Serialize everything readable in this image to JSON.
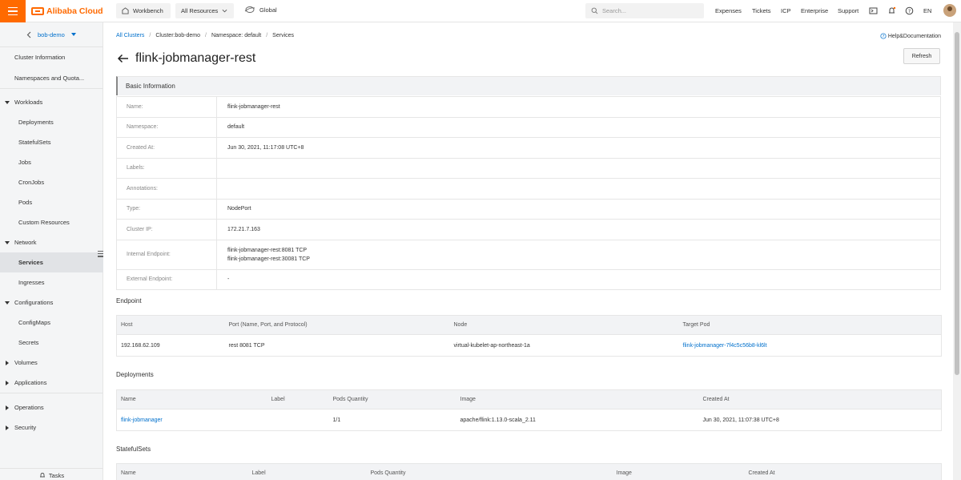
{
  "topbar": {
    "brand": "Alibaba Cloud",
    "workbench": "Workbench",
    "all_resources": "All Resources",
    "region": "Global",
    "search_placeholder": "Search...",
    "links": [
      "Expenses",
      "Tickets",
      "ICP",
      "Enterprise",
      "Support"
    ],
    "language": "EN",
    "accent_color": "#ff6a00"
  },
  "sidebar": {
    "cluster": "bob-demo",
    "items": [
      {
        "label": "Cluster Information",
        "kind": "top"
      },
      {
        "label": "Namespaces and Quota...",
        "kind": "top"
      },
      {
        "label": "Workloads",
        "kind": "group",
        "expanded": true
      },
      {
        "label": "Deployments",
        "kind": "sub"
      },
      {
        "label": "StatefulSets",
        "kind": "sub"
      },
      {
        "label": "Jobs",
        "kind": "sub"
      },
      {
        "label": "CronJobs",
        "kind": "sub"
      },
      {
        "label": "Pods",
        "kind": "sub"
      },
      {
        "label": "Custom Resources",
        "kind": "sub"
      },
      {
        "label": "Network",
        "kind": "group",
        "expanded": true
      },
      {
        "label": "Services",
        "kind": "sub",
        "active": true
      },
      {
        "label": "Ingresses",
        "kind": "sub"
      },
      {
        "label": "Configurations",
        "kind": "group",
        "expanded": true
      },
      {
        "label": "ConfigMaps",
        "kind": "sub"
      },
      {
        "label": "Secrets",
        "kind": "sub"
      },
      {
        "label": "Volumes",
        "kind": "group",
        "expanded": false
      },
      {
        "label": "Applications",
        "kind": "group",
        "expanded": false
      },
      {
        "label": "Operations",
        "kind": "group",
        "expanded": false
      },
      {
        "label": "Security",
        "kind": "group",
        "expanded": false
      }
    ],
    "tasks": "Tasks"
  },
  "breadcrumb": [
    "All Clusters",
    "Cluster:bob-demo",
    "Namespace: default",
    "Services"
  ],
  "help": "Help&Documentation",
  "page_title": "flink-jobmanager-rest",
  "refresh": "Refresh",
  "basic_info": {
    "title": "Basic Information",
    "rows": [
      {
        "key": "Name:",
        "values": [
          "flink-jobmanager-rest"
        ]
      },
      {
        "key": "Namespace:",
        "values": [
          "default"
        ]
      },
      {
        "key": "Created At:",
        "values": [
          "Jun 30, 2021, 11:17:08 UTC+8"
        ]
      },
      {
        "key": "Labels:",
        "values": []
      },
      {
        "key": "Annotations:",
        "values": []
      },
      {
        "key": "Type:",
        "values": [
          "NodePort"
        ]
      },
      {
        "key": "Cluster IP:",
        "values": [
          "172.21.7.163"
        ]
      },
      {
        "key": "Internal Endpoint:",
        "values": [
          "flink-jobmanager-rest:8081 TCP",
          "flink-jobmanager-rest:30081 TCP"
        ]
      },
      {
        "key": "External Endpoint:",
        "values": [
          "-"
        ]
      }
    ]
  },
  "endpoint": {
    "title": "Endpoint",
    "columns": [
      "Host",
      "Port (Name, Port, and Protocol)",
      "Node",
      "Target Pod"
    ],
    "rows": [
      [
        "192.168.62.109",
        "rest 8081 TCP",
        "virtual-kubelet-ap-northeast-1a",
        "flink-jobmanager-7f4c5c56b8-kl6lt"
      ]
    ]
  },
  "deployments": {
    "title": "Deployments",
    "columns": [
      "Name",
      "Label",
      "Pods Quantity",
      "Image",
      "Created At"
    ],
    "rows": [
      [
        "flink-jobmanager",
        "",
        "1/1",
        "apache/flink:1.13.0-scala_2.11",
        "Jun 30, 2021, 11:07:38 UTC+8"
      ]
    ]
  },
  "statefulsets": {
    "title": "StatefulSets",
    "columns": [
      "Name",
      "Label",
      "Pods Quantity",
      "Image",
      "Created At"
    ]
  },
  "link_color": "#0070cc"
}
